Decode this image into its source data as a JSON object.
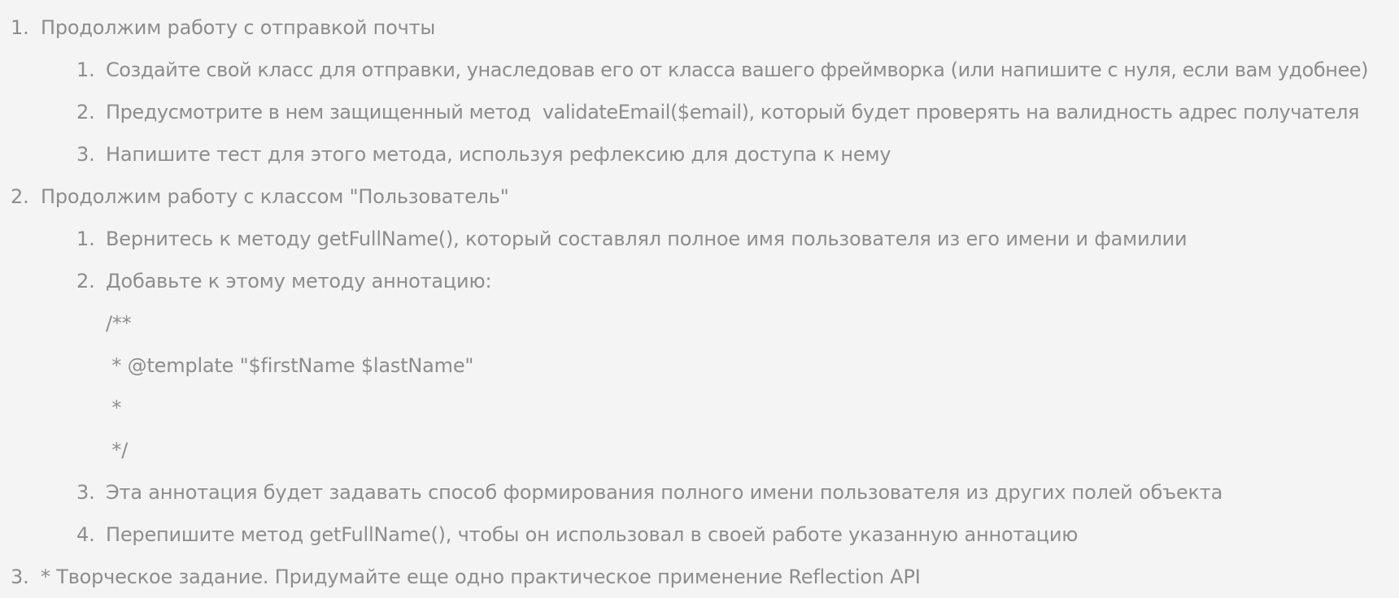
{
  "task_list": {
    "items": [
      {
        "number": "1.",
        "text": "Продолжим работу с отправкой почты",
        "subitems": [
          {
            "number": "1.",
            "text": "Создайте свой класс для отправки, унаследовав его от класса вашего фреймворка (или напишите с нуля, если вам удобнее)"
          },
          {
            "number": "2.",
            "text": "Предусмотрите в нем защищенный метод  validateEmail($email), который будет проверять на валидность адрес получателя"
          },
          {
            "number": "3.",
            "text": "Напишите тест для этого метода, используя рефлексию для доступа к нему"
          }
        ]
      },
      {
        "number": "2.",
        "text": "Продолжим работу с классом \"Пользователь\"",
        "subitems": [
          {
            "number": "1.",
            "text": "Вернитесь к методу getFullName(), который составлял полное имя пользователя из его имени и фамилии"
          },
          {
            "number": "2.",
            "text": "Добавьте к этому методу аннотацию:"
          },
          {
            "number": "3.",
            "text": "Эта аннотация будет задавать способ формирования полного имени пользователя из других полей объекта"
          },
          {
            "number": "4.",
            "text": "Перепишите метод getFullName(), чтобы он использовал в своей работе указанную аннотацию"
          }
        ],
        "code_lines": [
          "/**",
          " * @template \"$firstName $lastName\"",
          " *",
          " */"
        ]
      },
      {
        "number": "3.",
        "text": "* Творческое задание. Придумайте еще одно практическое применение Reflection API"
      }
    ]
  }
}
